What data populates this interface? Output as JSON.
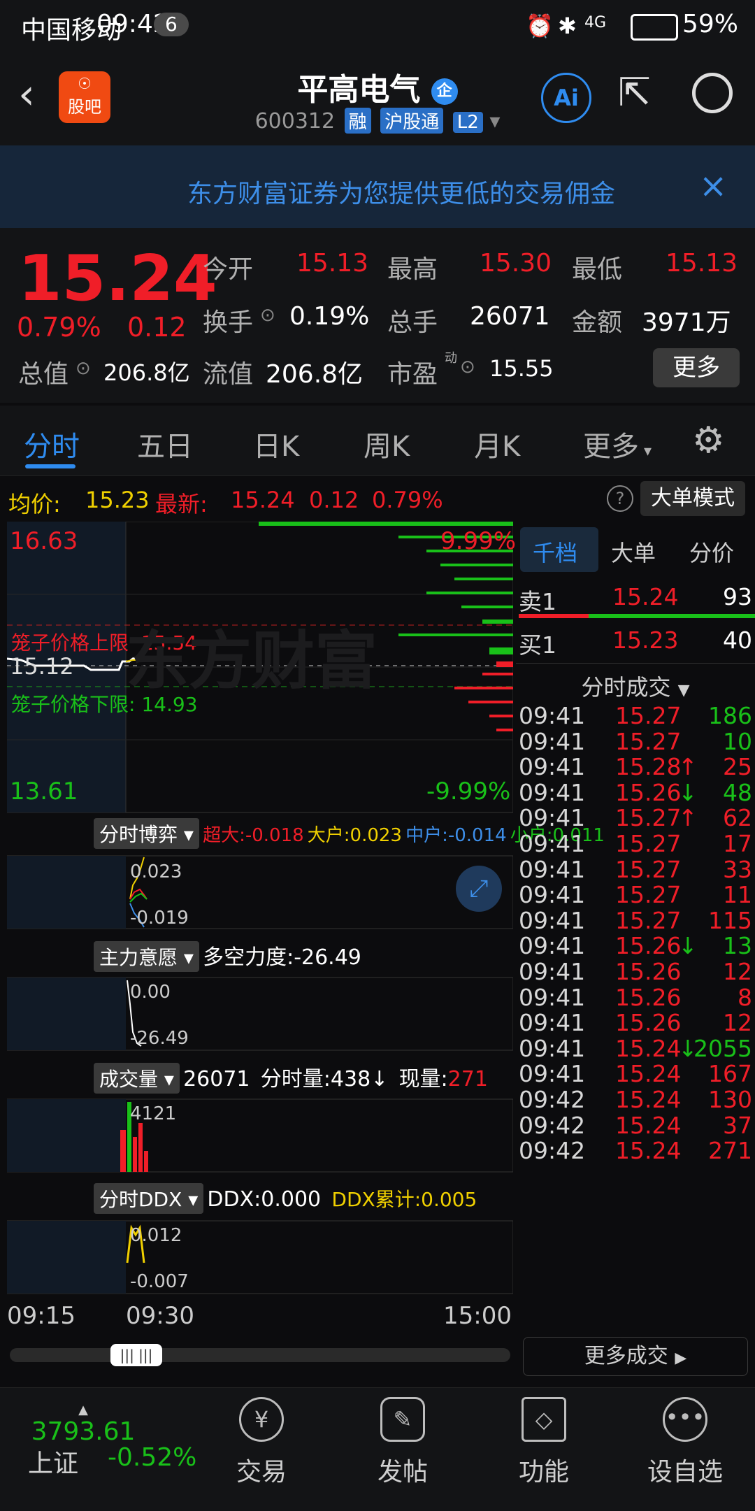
{
  "status": {
    "carrier": "中国移动",
    "time": "09:42",
    "notif_count": "6",
    "signal": "4G",
    "battery": "59%"
  },
  "header": {
    "stock_name": "平高电气",
    "code": "600312",
    "tags": [
      "融",
      "沪股通",
      "L2"
    ],
    "logo_text": "股吧",
    "ent_badge": "企",
    "ai_label": "Ai"
  },
  "banner": {
    "message": "东方财富证券为您提供更低的交易佣金"
  },
  "quote": {
    "price": "15.24",
    "change_pct": "0.79%",
    "change_amt": "0.12",
    "labels": {
      "open": "今开",
      "high": "最高",
      "low": "最低",
      "turnover": "换手",
      "volume": "总手",
      "amount": "金额",
      "market_cap": "总值",
      "float_cap": "流值",
      "pe": "市盈",
      "pe_sup": "动",
      "more": "更多"
    },
    "open": "15.13",
    "high": "15.30",
    "low": "15.13",
    "turnover": "0.19%",
    "volume": "26071",
    "amount": "3971万",
    "market_cap": "206.8亿",
    "float_cap": "206.8亿",
    "pe": "15.55"
  },
  "tabs": [
    "分时",
    "五日",
    "日K",
    "周K",
    "月K",
    "更多"
  ],
  "info_row": {
    "avg_label": "均价:",
    "avg": "15.23",
    "latest_label": "最新:",
    "latest": "15.24",
    "chg": "0.12",
    "pct": "0.79%",
    "bigmode": "大单模式",
    "help": "?"
  },
  "main_chart": {
    "y_top": "16.63",
    "y_bottom": "13.61",
    "pct_top": "9.99%",
    "pct_bottom": "-9.99%",
    "mid": "15.12",
    "upper_label": "笼子价格上限",
    "upper_val": "15.54",
    "lower_label": "笼子价格下限:",
    "lower_val": "14.93",
    "watermark": "东方财富"
  },
  "indicator1": {
    "name": "分时博弈",
    "items": [
      {
        "label": "超大:",
        "val": "-0.018",
        "color": "#f01e28"
      },
      {
        "label": "大户:",
        "val": "0.023",
        "color": "#f0d000"
      },
      {
        "label": "中户:",
        "val": "-0.014",
        "color": "#3d8ee8"
      },
      {
        "label": "小户:",
        "val": "0.011",
        "color": "#19c019"
      }
    ],
    "top_val": "0.023",
    "bottom_val": "-0.019"
  },
  "indicator2": {
    "name": "主力意愿",
    "label": "多空力度:",
    "val": "-26.49",
    "top_val": "0.00",
    "bottom_val": "-26.49"
  },
  "indicator3": {
    "name": "成交量",
    "total": "26071",
    "fen_label": "分时量:",
    "fen_val": "438↓",
    "xian_label": "现量:",
    "xian_val": "271",
    "top_val": "4121"
  },
  "indicator4": {
    "name": "分时DDX",
    "ddx_label": "DDX:",
    "ddx_val": "0.000",
    "ddx_cum_label": "DDX累计:",
    "ddx_cum_val": "0.005",
    "top_val": "0.012",
    "bottom_val": "-0.007"
  },
  "time_axis": [
    "09:15",
    "09:30",
    "15:00"
  ],
  "right_panel": {
    "tabs": [
      "千档",
      "大单",
      "分价"
    ],
    "sell1_label": "卖1",
    "sell1_price": "15.24",
    "sell1_vol": "93",
    "buy1_label": "买1",
    "buy1_price": "15.23",
    "buy1_vol": "40",
    "trades_title": "分时成交",
    "trades": [
      {
        "t": "09:41",
        "p": "15.27",
        "arrow": "",
        "v": "186",
        "vc": "green"
      },
      {
        "t": "09:41",
        "p": "15.27",
        "arrow": "",
        "v": "10",
        "vc": "green"
      },
      {
        "t": "09:41",
        "p": "15.28",
        "arrow": "↑",
        "v": "25",
        "vc": "red"
      },
      {
        "t": "09:41",
        "p": "15.26",
        "arrow": "↓",
        "v": "48",
        "vc": "green"
      },
      {
        "t": "09:41",
        "p": "15.27",
        "arrow": "↑",
        "v": "62",
        "vc": "red"
      },
      {
        "t": "09:41",
        "p": "15.27",
        "arrow": "",
        "v": "17",
        "vc": "red"
      },
      {
        "t": "09:41",
        "p": "15.27",
        "arrow": "",
        "v": "33",
        "vc": "red"
      },
      {
        "t": "09:41",
        "p": "15.27",
        "arrow": "",
        "v": "11",
        "vc": "red"
      },
      {
        "t": "09:41",
        "p": "15.27",
        "arrow": "",
        "v": "115",
        "vc": "red"
      },
      {
        "t": "09:41",
        "p": "15.26",
        "arrow": "↓",
        "v": "13",
        "vc": "green"
      },
      {
        "t": "09:41",
        "p": "15.26",
        "arrow": "",
        "v": "12",
        "vc": "red"
      },
      {
        "t": "09:41",
        "p": "15.26",
        "arrow": "",
        "v": "8",
        "vc": "red"
      },
      {
        "t": "09:41",
        "p": "15.26",
        "arrow": "",
        "v": "12",
        "vc": "red"
      },
      {
        "t": "09:41",
        "p": "15.24",
        "arrow": "↓",
        "v": "2055",
        "vc": "green"
      },
      {
        "t": "09:41",
        "p": "15.24",
        "arrow": "",
        "v": "167",
        "vc": "red"
      },
      {
        "t": "09:42",
        "p": "15.24",
        "arrow": "",
        "v": "130",
        "vc": "red"
      },
      {
        "t": "09:42",
        "p": "15.24",
        "arrow": "",
        "v": "37",
        "vc": "red"
      },
      {
        "t": "09:42",
        "p": "15.24",
        "arrow": "",
        "v": "271",
        "vc": "red"
      }
    ],
    "more_trades": "更多成交"
  },
  "bottom_nav": {
    "index_value": "3793.61",
    "index_name": "上证",
    "index_change": "-0.52%",
    "items": [
      "交易",
      "发帖",
      "功能",
      "设自选"
    ]
  },
  "colors": {
    "up": "#f01e28",
    "down": "#19c019",
    "accent": "#2f8cf0"
  }
}
